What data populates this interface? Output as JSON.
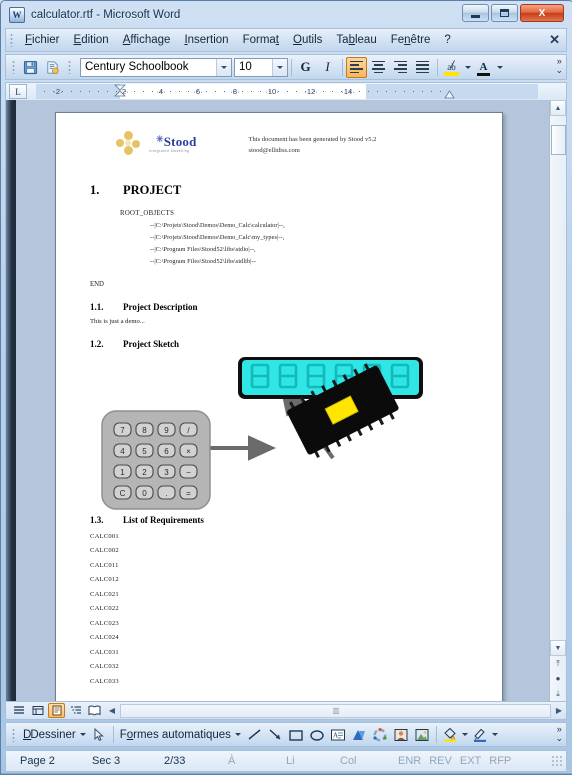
{
  "window": {
    "title": "calculator.rtf - Microsoft Word",
    "app_icon": "word-icon",
    "icon_letter": "W",
    "minimize_label": "Minimize",
    "maximize_label": "Restore",
    "close_label": "X"
  },
  "menubar": {
    "items": [
      {
        "label": "Fichier",
        "accel": "F"
      },
      {
        "label": "Edition",
        "accel": "E"
      },
      {
        "label": "Affichage",
        "accel": "A"
      },
      {
        "label": "Insertion",
        "accel": "I"
      },
      {
        "label": "Format",
        "accel": "t"
      },
      {
        "label": "Outils",
        "accel": "O"
      },
      {
        "label": "Tableau",
        "accel": "b"
      },
      {
        "label": "Fenêtre",
        "accel": "n"
      },
      {
        "label": "?",
        "accel": ""
      }
    ],
    "close_document_label": "✕"
  },
  "toolbar": {
    "save_label": "save-icon",
    "permission_label": "permission-icon",
    "font_name": "Century Schoolbook",
    "font_size": "10",
    "bold_label": "G",
    "italic_label": "I",
    "align_left_label": "align-left",
    "align_center_label": "align-center",
    "align_right_label": "align-right",
    "align_justify_label": "align-justify",
    "highlight_label": "ab",
    "font_color_label": "A",
    "overflow_label": "»"
  },
  "ruler": {
    "tab_selector_label": "L",
    "ticks": [
      "2",
      "2",
      "4",
      "6",
      "8",
      "10",
      "12",
      "14"
    ]
  },
  "document": {
    "logo_text": "Stood",
    "logo_star": "✳",
    "logo_subtitle": "Integrated Modelling",
    "generated_note_line1": "This document has been generated by Stood v5.2",
    "generated_note_line2": "stood@ellidiss.com",
    "h1_number": "1.",
    "h1_title": "PROJECT",
    "root_objects_label": "ROOT_OBJECTS",
    "root_objects": [
      "--|C:\\Projets\\Stood\\Demos\\Demo_Calc\\calculator|--,",
      "--|C:\\Projets\\Stood\\Demos\\Demo_Calc\\my_types|--,",
      "--|C:\\Program Files\\Stood52\\libs\\stdio|--,",
      "--|C:\\Program Files\\Stood52\\libs\\stdlib|--"
    ],
    "end_label": "END",
    "h2_1_number": "1.1.",
    "h2_1_title": "Project Description",
    "description_text": "This is just a demo...",
    "h2_2_number": "1.2.",
    "h2_2_title": "Project Sketch",
    "h2_3_number": "1.3.",
    "h2_3_title": "List of Requirements",
    "requirements": [
      "CALC001",
      "CALC002",
      "CALC011",
      "CALC012",
      "CALC021",
      "CALC022",
      "CALC023",
      "CALC024",
      "CALC031",
      "CALC032",
      "CALC033"
    ]
  },
  "sketch": {
    "display_segments": "888888",
    "display_color": "#2ee6e6",
    "keypad_color": "#b5b5b5",
    "chip_color": "#0b0b0b",
    "chip_die_color": "#ffe600",
    "keypad_keys": [
      "7",
      "8",
      "9",
      "/",
      "4",
      "5",
      "6",
      "×",
      "1",
      "2",
      "3",
      "−",
      "C",
      "0",
      ".",
      "="
    ]
  },
  "viewbar": {
    "buttons": [
      "normal-view",
      "web-layout-view",
      "print-layout-view",
      "outline-view",
      "reading-layout-view"
    ],
    "active_index": 2,
    "scroll_left_label": "◀",
    "scroll_right_label": "▶"
  },
  "drawbar": {
    "draw_label": "Dessiner",
    "select_label": "select-objects",
    "autoshapes_label": "Formes automatiques",
    "tools": [
      "line-icon",
      "arrow-icon",
      "rectangle-icon",
      "oval-icon",
      "text-box-icon",
      "wordart-icon",
      "diagram-icon",
      "clip-art-icon",
      "picture-icon"
    ],
    "fill_color_label": "fill-color-icon",
    "line_color_label": "line-color-icon",
    "overflow_label": "»"
  },
  "statusbar": {
    "page_label": "Page 2",
    "section_label": "Sec 3",
    "page_count": "2/33",
    "at_label": "À",
    "line_label": "Li",
    "column_label": "Col",
    "mode_rec": "ENR",
    "mode_rev": "REV",
    "mode_ext": "EXT",
    "mode_ovr": "RFP"
  },
  "scrollbar": {
    "up_label": "▲",
    "down_label": "▼",
    "prev_page_label": "⤒",
    "browse_object_label": "●",
    "next_page_label": "⤓"
  },
  "colors": {
    "accent": "#fbb65a",
    "titlebar": "#cfe0f2",
    "close_button": "#c63d1b",
    "chrome": "#d6e4f4"
  }
}
